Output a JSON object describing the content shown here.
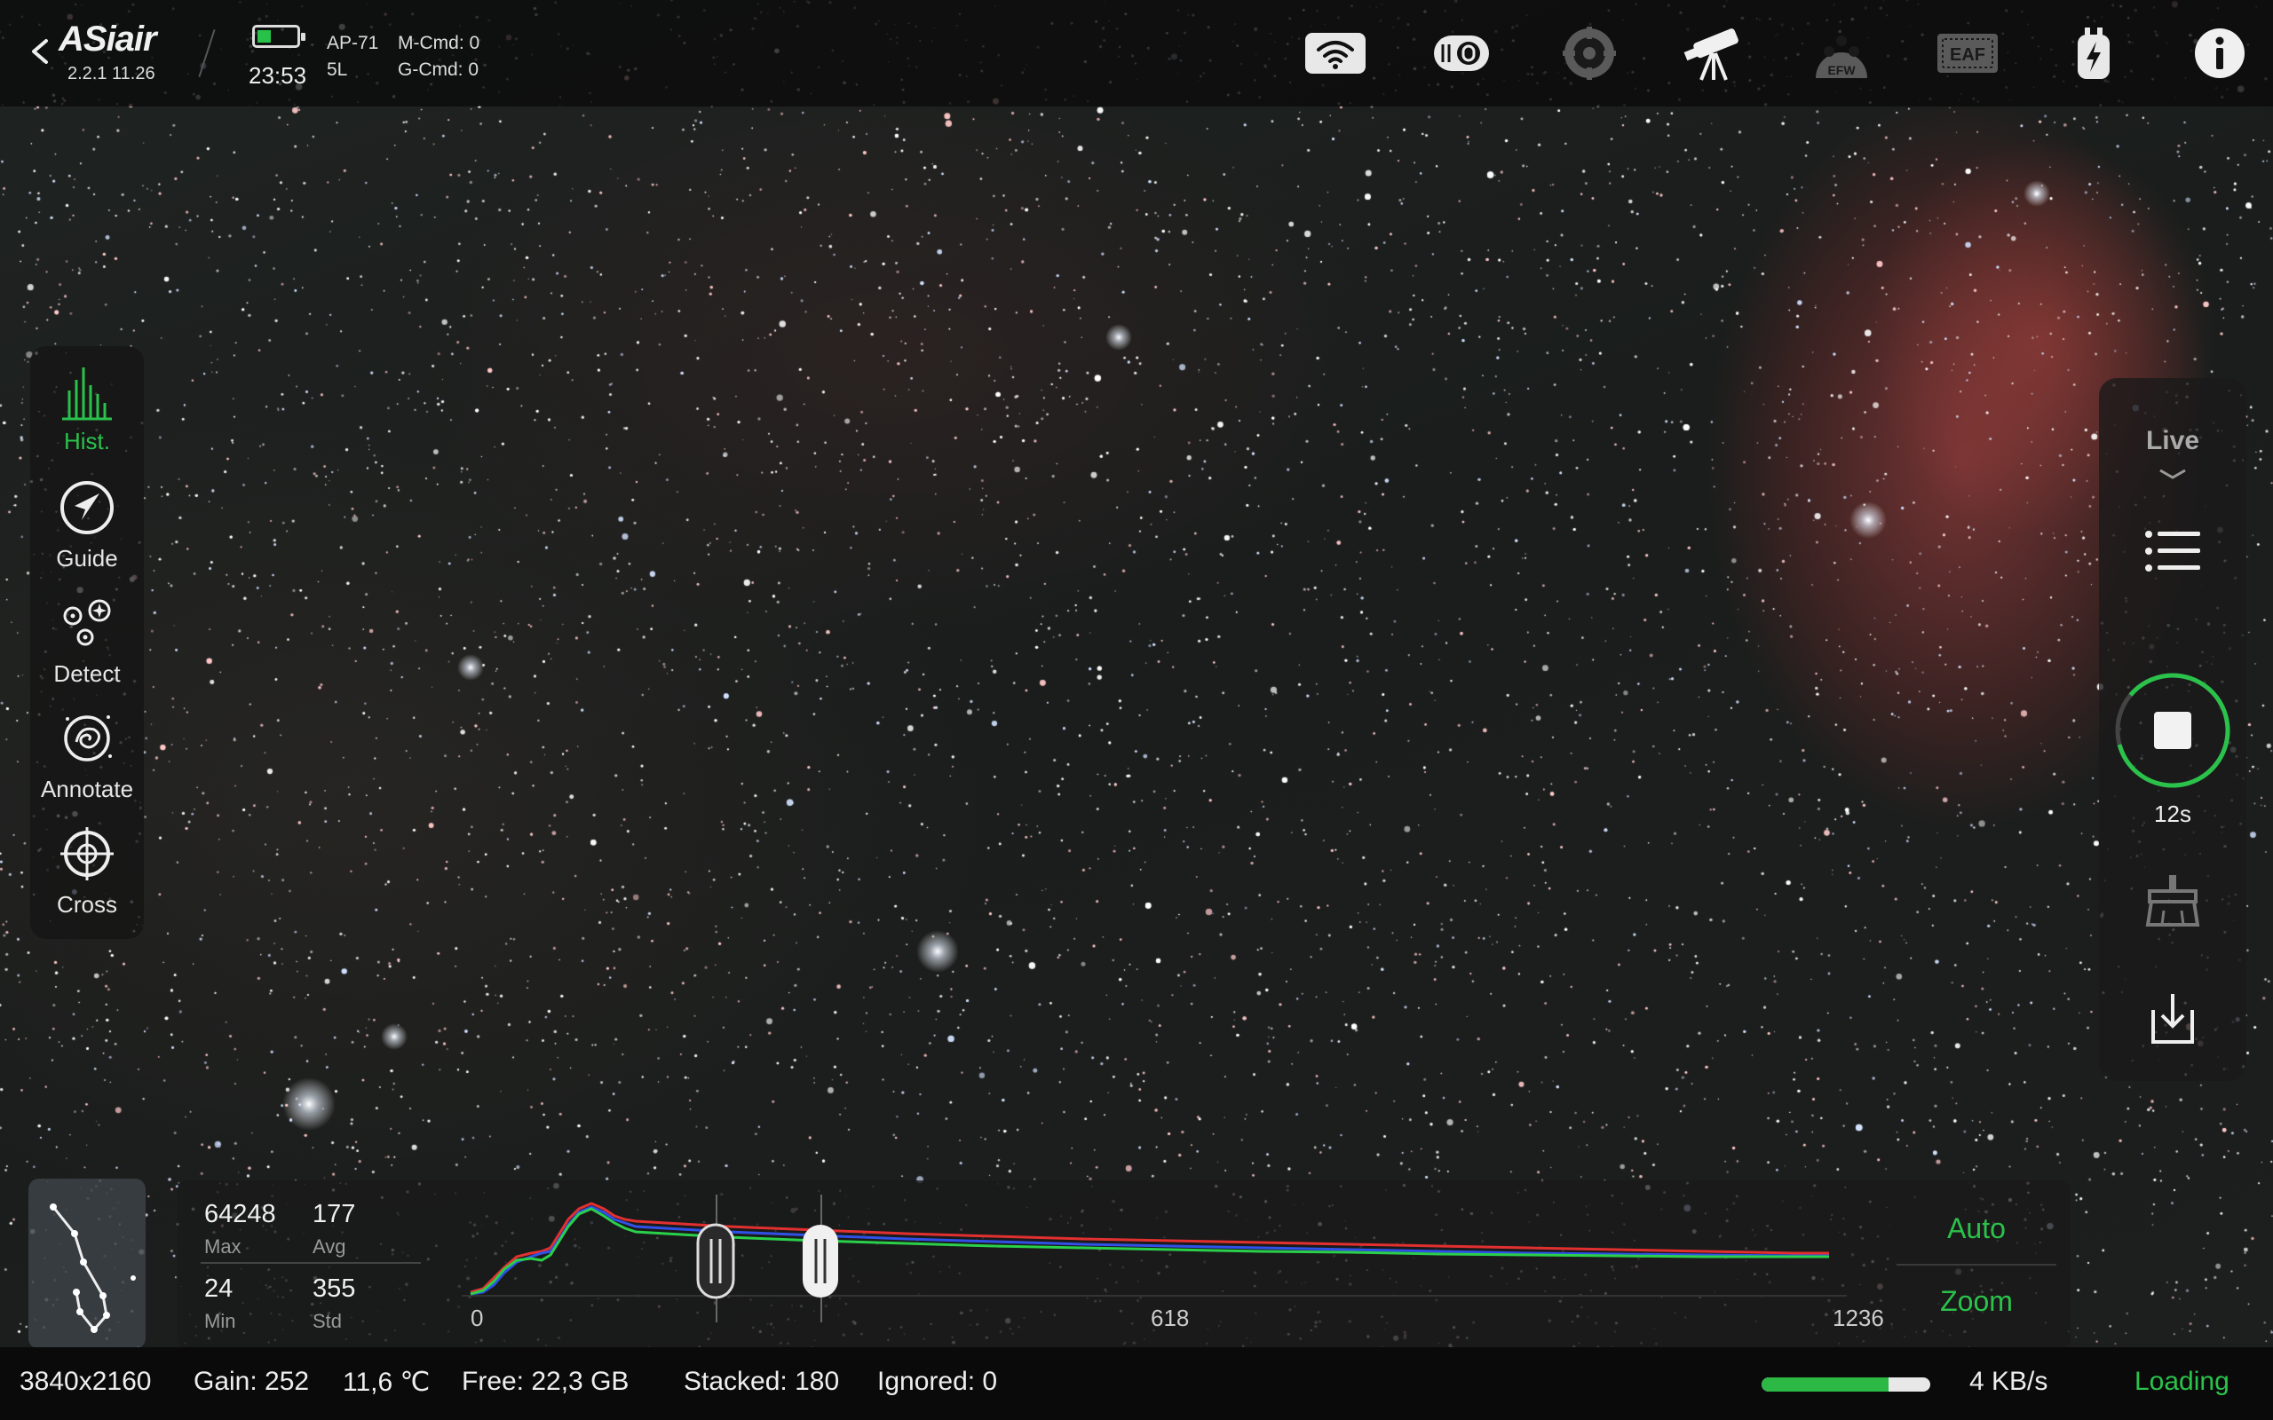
{
  "app": {
    "logo": "ASiair",
    "version": "2.2.1 11.26",
    "time": "23:53",
    "device_line1": "AP-71",
    "device_line2": "5L",
    "mcmd": "M-Cmd: 0",
    "gcmd": "G-Cmd: 0",
    "battery_level": 0.35
  },
  "top_icons": [
    "wifi-icon",
    "camera-icon",
    "guide-scope-icon",
    "telescope-icon",
    "filter-wheel-icon",
    "focuser-icon",
    "power-icon",
    "info-icon"
  ],
  "top_icon_text": {
    "efw": "EFW",
    "eaf": "EAF"
  },
  "tools": {
    "hist": "Hist.",
    "guide": "Guide",
    "detect": "Detect",
    "annotate": "Annotate",
    "cross": "Cross"
  },
  "right_panel": {
    "mode": "Live",
    "exposure": "12s"
  },
  "histogram": {
    "max_value": "64248",
    "max_label": "Max",
    "avg_value": "177",
    "avg_label": "Avg",
    "min_value": "24",
    "min_label": "Min",
    "std_value": "355",
    "std_label": "Std",
    "axis_start": "0",
    "axis_mid": "618",
    "axis_end": "1236",
    "auto_label": "Auto",
    "zoom_label": "Zoom"
  },
  "status": {
    "resolution": "3840x2160",
    "gain": "Gain: 252",
    "temperature": "11,6 ℃",
    "free_space": "Free: 22,3 GB",
    "stacked": "Stacked: 180",
    "ignored": "Ignored: 0",
    "download_progress": 0.75,
    "speed": "4 KB/s",
    "state": "Loading"
  },
  "colors": {
    "accent": "#2bc24b",
    "hist_red": "#e23030",
    "hist_green": "#2ad04a",
    "hist_blue": "#3050e8"
  }
}
